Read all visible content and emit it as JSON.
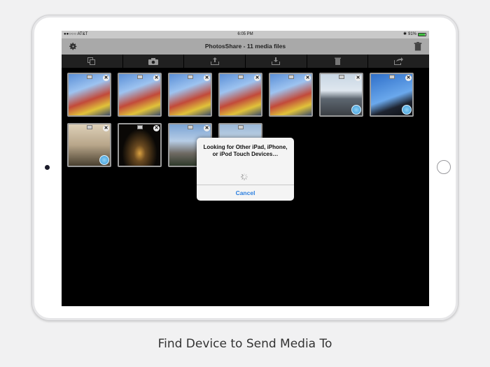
{
  "status_bar": {
    "carrier": "●●○○○ AT&T",
    "time": "6:05 PM",
    "bluetooth": "✱",
    "battery_percent": "91%",
    "battery_level": 0.91
  },
  "nav_bar": {
    "title": "PhotosShare - 11 media files",
    "left_icon": "gear-icon",
    "right_icon": "trash-icon"
  },
  "toolbar": {
    "items": [
      {
        "icon": "copy-icon"
      },
      {
        "icon": "camera-icon"
      },
      {
        "icon": "upload-icon"
      },
      {
        "icon": "download-icon"
      },
      {
        "icon": "trash-icon"
      },
      {
        "icon": "share-icon"
      }
    ]
  },
  "media_grid": {
    "items": [
      {
        "kind": "photo",
        "scene": "carnival ride",
        "close_glyph": "✕",
        "video": false
      },
      {
        "kind": "photo",
        "scene": "carnival ride",
        "close_glyph": "✕",
        "video": false
      },
      {
        "kind": "photo",
        "scene": "carnival ride",
        "close_glyph": "✕",
        "video": false
      },
      {
        "kind": "photo",
        "scene": "carnival ride",
        "close_glyph": "✕",
        "video": false
      },
      {
        "kind": "photo",
        "scene": "carnival ride",
        "close_glyph": "✕",
        "video": false
      },
      {
        "kind": "video",
        "scene": "road",
        "close_glyph": "✕",
        "video": true
      },
      {
        "kind": "video",
        "scene": "sky",
        "close_glyph": "✕",
        "video": true
      },
      {
        "kind": "video",
        "scene": "indoor",
        "close_glyph": "✕",
        "video": true
      },
      {
        "kind": "photo",
        "scene": "eiffel tower night",
        "close_glyph": "✕",
        "video": false
      },
      {
        "kind": "video",
        "scene": "castle",
        "close_glyph": "✕",
        "video": true
      },
      {
        "kind": "photo",
        "scene": "beach",
        "close_glyph": "",
        "video": false
      }
    ]
  },
  "dialog": {
    "message": "Looking for Other iPad, iPhone, or iPod Touch Devices…",
    "cancel_label": "Cancel"
  },
  "caption": "Find Device to Send Media To"
}
